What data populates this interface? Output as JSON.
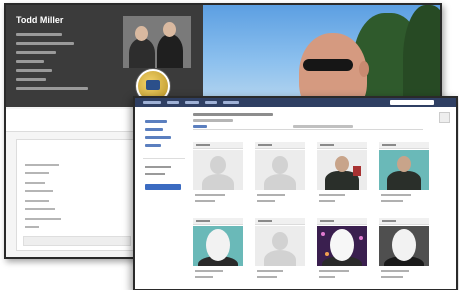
{
  "profile": {
    "name": "Todd Miller"
  }
}
